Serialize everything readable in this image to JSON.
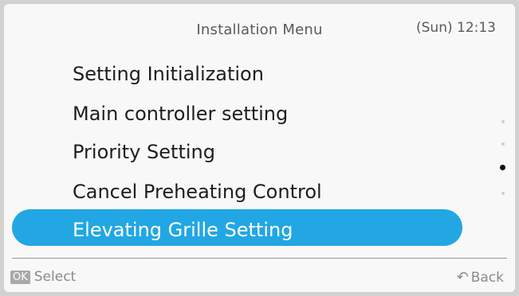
{
  "header": {
    "title": "Installation Menu",
    "clock": "(Sun) 12:13"
  },
  "menu": {
    "items": [
      {
        "label": "Setting Initialization"
      },
      {
        "label": "Main controller setting"
      },
      {
        "label": "Priority Setting"
      },
      {
        "label": "Cancel Preheating Control"
      },
      {
        "label": "Elevating Grille Setting"
      }
    ],
    "selected_index": 4
  },
  "footer": {
    "ok_label": "OK",
    "select_label": "Select",
    "back_label": "Back"
  },
  "colors": {
    "highlight": "#22a7e4",
    "screen_bg": "#f8f8f8"
  },
  "icons": {
    "back": "back-arrow-icon",
    "scroll": "scroll-indicator-icon"
  }
}
